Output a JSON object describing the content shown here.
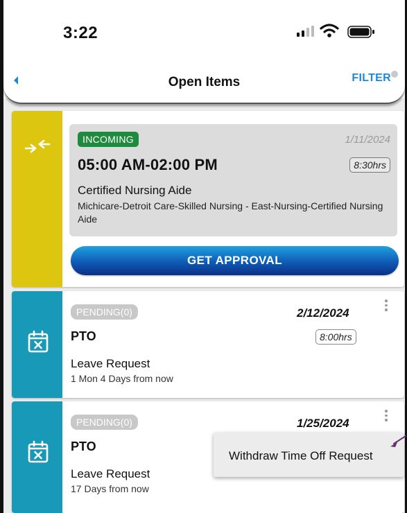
{
  "status_bar": {
    "time": "3:22"
  },
  "header": {
    "title": "Open Items",
    "filter_label": "FILTER"
  },
  "cards": [
    {
      "badge": "INCOMING",
      "date": "1/11/2024",
      "time_range": "05:00 AM-02:00 PM",
      "hours": "8:30hrs",
      "role": "Certified Nursing Aide",
      "location": "Michicare-Detroit Care-Skilled Nursing - East-Nursing-Certified Nursing Aide",
      "action_label": "GET APPROVAL",
      "accent": "#ddc60f"
    },
    {
      "badge": "PENDING(0)",
      "date": "2/12/2024",
      "type": "PTO",
      "hours": "8:00hrs",
      "request_type": "Leave Request",
      "relative": "1 Mon 4 Days from now",
      "accent": "#1899b7"
    },
    {
      "badge": "PENDING(0)",
      "date": "1/25/2024",
      "type": "PTO",
      "request_type": "Leave Request",
      "relative": "17 Days from now",
      "accent": "#1899b7"
    }
  ],
  "context_menu": {
    "items": [
      "Withdraw Time Off Request"
    ]
  },
  "colors": {
    "filter": "#1e88d8",
    "incoming_badge": "#1d8a3e",
    "approve_button": "#0f5bb5"
  },
  "icons": [
    "signal-icon",
    "wifi-icon",
    "battery-icon",
    "back-icon",
    "swap-icon",
    "calendar-x-icon",
    "kebab-icon"
  ]
}
